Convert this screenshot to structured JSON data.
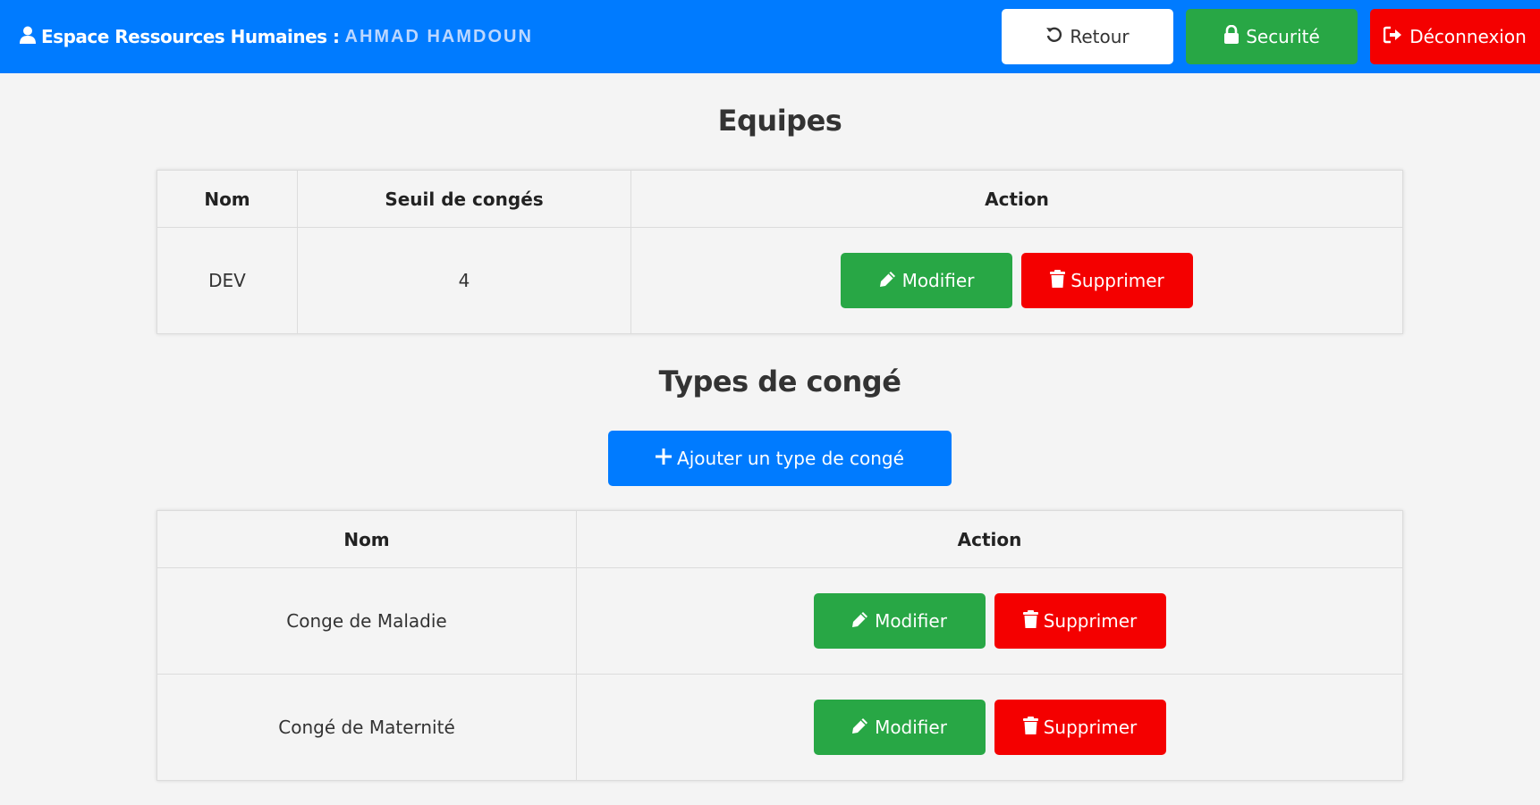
{
  "header": {
    "title": "Espace Ressources Humaines :",
    "user_name": "AHMAD HAMDOUN",
    "back_label": "Retour",
    "security_label": "Securité",
    "logout_label": "Déconnexion"
  },
  "teams": {
    "title": "Equipes",
    "columns": [
      "Nom",
      "Seuil de congés",
      "Action"
    ],
    "rows": [
      {
        "name": "DEV",
        "threshold": "4"
      }
    ]
  },
  "leave_types": {
    "title": "Types de congé",
    "add_label": "Ajouter un type de congé",
    "columns": [
      "Nom",
      "Action"
    ],
    "rows": [
      {
        "name": "Conge de Maladie"
      },
      {
        "name": "Congé de Maternité"
      }
    ]
  },
  "actions": {
    "edit_label": "Modifier",
    "delete_label": "Supprimer"
  },
  "colors": {
    "primary": "#007bff",
    "success": "#28a745",
    "danger": "#f40000",
    "background": "#f4f4f4"
  }
}
